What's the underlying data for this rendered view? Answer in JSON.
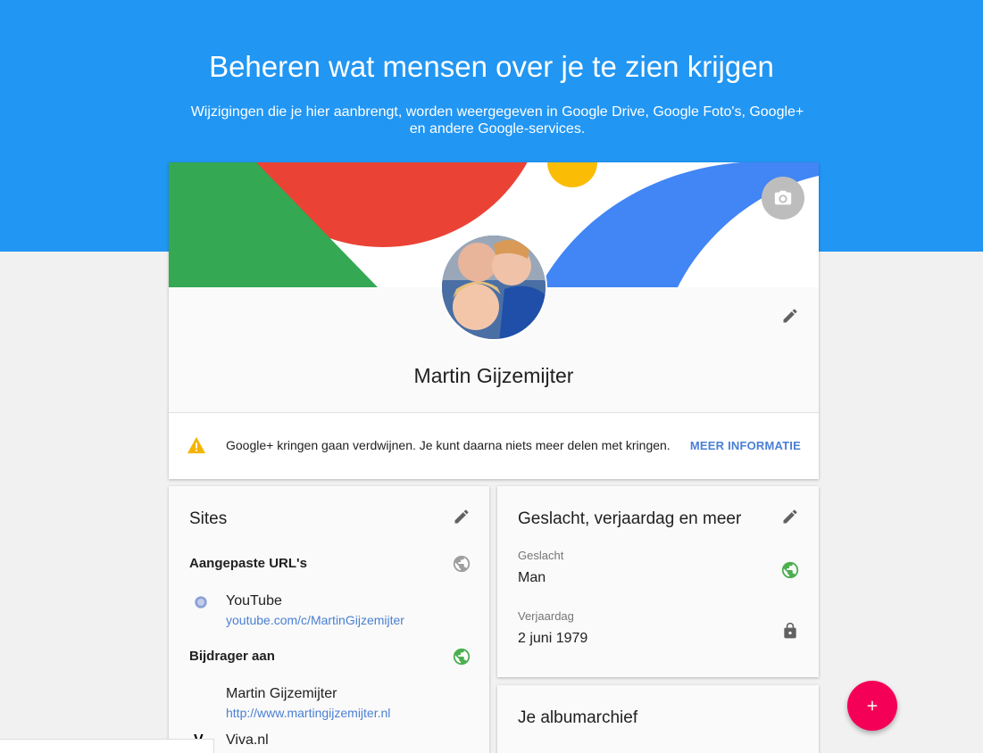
{
  "header": {
    "title": "Beheren wat mensen over je te zien krijgen",
    "subtitle": "Wijzigingen die je hier aanbrengt, worden weergegeven in Google Drive, Google Foto's, Google+ en andere Google-services."
  },
  "profile": {
    "name": "Martin Gijzemijter",
    "cover_icon": "camera-icon",
    "edit_icon": "pencil-icon"
  },
  "notice": {
    "text": "Google+ kringen gaan verdwijnen. Je kunt daarna niets meer delen met kringen.",
    "link": "MEER INFORMATIE",
    "icon": "warning-icon"
  },
  "sites": {
    "title": "Sites",
    "custom_urls_label": "Aangepaste URL's",
    "custom_urls": [
      {
        "title": "YouTube",
        "url": "youtube.com/c/MartinGijzemijter"
      }
    ],
    "contributor_label": "Bijdrager aan",
    "contributor": [
      {
        "title": "Martin Gijzemijter",
        "url": "http://www.martingijzemijter.nl"
      },
      {
        "title": "Viva.nl",
        "url": ""
      }
    ]
  },
  "about": {
    "title": "Geslacht, verjaardag en meer",
    "fields": [
      {
        "label": "Geslacht",
        "value": "Man",
        "visibility": "public-icon"
      },
      {
        "label": "Verjaardag",
        "value": "2 juni 1979",
        "visibility": "lock-icon"
      }
    ]
  },
  "album": {
    "title": "Je albumarchief"
  },
  "colors": {
    "header_blue": "#2196f3",
    "link_blue": "#4a7fd4",
    "public_green": "#4caf50",
    "fab_pink": "#f50057",
    "warning_yellow": "#f4b400"
  }
}
